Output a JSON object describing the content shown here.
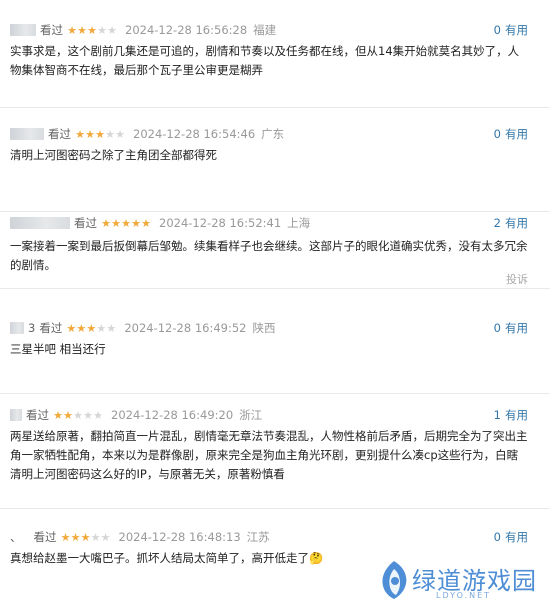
{
  "comments": [
    {
      "user": "",
      "watched": "看过",
      "rating": 3,
      "time": "2024-12-28 16:56:28",
      "location": "福建",
      "useful_count": "0",
      "useful_label": "有用",
      "content": "实事求是，这个剧前几集还是可追的，剧情和节奏以及任务都在线，但从14集开始就莫名其妙了，人物集体智商不在线，最后那个瓦子里公审更是糊弄"
    },
    {
      "user": "",
      "watched": "看过",
      "rating": 3,
      "time": "2024-12-28 16:54:46",
      "location": "广东",
      "useful_count": "0",
      "useful_label": "有用",
      "content": "清明上河图密码之除了主角团全部都得死"
    },
    {
      "user": "",
      "watched": "看过",
      "rating": 5,
      "time": "2024-12-28 16:52:41",
      "location": "上海",
      "useful_count": "2",
      "useful_label": "有用",
      "content": "一案接着一案到最后扳倒幕后邹勉。续集看样子也会继续。这部片子的眼化道确实优秀，没有太多冗余的剧情。",
      "report": "投诉"
    },
    {
      "user": "3",
      "watched": "看过",
      "rating": 3,
      "time": "2024-12-28 16:49:52",
      "location": "陕西",
      "useful_count": "0",
      "useful_label": "有用",
      "content": "三星半吧 相当还行"
    },
    {
      "user": "",
      "watched": "看过",
      "rating": 2,
      "time": "2024-12-28 16:49:20",
      "location": "浙江",
      "useful_count": "1",
      "useful_label": "有用",
      "content": "两星送给原著，翻拍简直一片混乱，剧情毫无章法节奏混乱，人物性格前后矛盾，后期完全为了突出主角一家牺牲配角，本来以为是群像剧，原来完全是狗血主角光环剧，更别提什么凑cp这些行为，白瞎清明上河图密码这么好的IP，与原著无关，原著粉慎看"
    },
    {
      "user": "、",
      "watched": "看过",
      "rating": 3,
      "time": "2024-12-28 16:48:13",
      "location": "江苏",
      "useful_count": "0",
      "useful_label": "有用",
      "content": "真想给赵墨一大嘴巴子。抓坏人结局太简单了，高开低走了🤔"
    }
  ],
  "watermark": {
    "name": "绿道游戏园",
    "domain": "LDYO.NET"
  },
  "colors": {
    "star": "#f2a93b",
    "link": "#3377aa",
    "logo": "#4e8ed6"
  }
}
